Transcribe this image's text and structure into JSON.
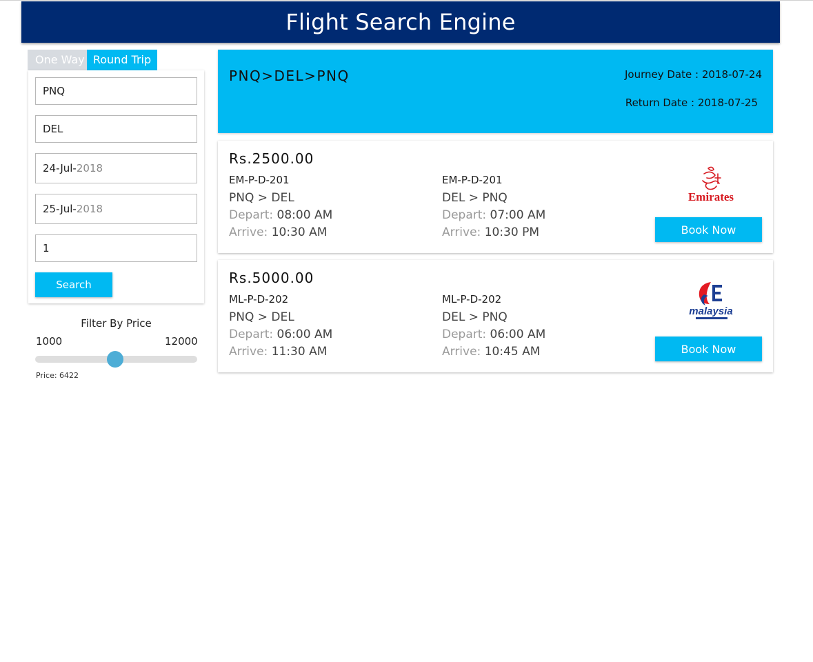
{
  "header": {
    "title": "Flight Search Engine"
  },
  "tabs": [
    {
      "label": "One Way",
      "active": false
    },
    {
      "label": "Round Trip",
      "active": true
    }
  ],
  "search": {
    "origin": "PNQ",
    "destination": "DEL",
    "depart_date": {
      "day_month": "24-Jul-",
      "year": "2018"
    },
    "return_date": {
      "day_month": "25-Jul-",
      "year": "2018"
    },
    "passengers": "1",
    "button_label": "Search"
  },
  "filter": {
    "title": "Filter By Price",
    "min_label": "1000",
    "max_label": "12000",
    "min": 1000,
    "max": 12000,
    "value": 6422,
    "price_text": "Price: 6422"
  },
  "results_header": {
    "route": "PNQ>DEL>PNQ",
    "journey_date": "Journey Date : 2018-07-24",
    "return_date": "Return Date : 2018-07-25"
  },
  "flights": [
    {
      "price": "Rs.2500.00",
      "outbound": {
        "code": "EM-P-D-201",
        "route": "PNQ > DEL",
        "depart_label": "Depart:",
        "depart_time": "08:00 AM",
        "arrive_label": "Arrive:",
        "arrive_time": "10:30 AM"
      },
      "return": {
        "code": "EM-P-D-201",
        "route": "DEL > PNQ",
        "depart_label": "Depart:",
        "depart_time": "07:00 AM",
        "arrive_label": "Arrive:",
        "arrive_time": "10:30 PM"
      },
      "logo_icon": "emirates-logo",
      "logo_text": "Emirates",
      "book_label": "Book Now"
    },
    {
      "price": "Rs.5000.00",
      "outbound": {
        "code": "ML-P-D-202",
        "route": "PNQ > DEL",
        "depart_label": "Depart:",
        "depart_time": "06:00 AM",
        "arrive_label": "Arrive:",
        "arrive_time": "11:30 AM"
      },
      "return": {
        "code": "ML-P-D-202",
        "route": "DEL > PNQ",
        "depart_label": "Depart:",
        "depart_time": "06:00 AM",
        "arrive_label": "Arrive:",
        "arrive_time": "10:45 AM"
      },
      "logo_icon": "malaysia-airlines-logo",
      "logo_text": "malaysia",
      "book_label": "Book Now"
    }
  ],
  "colors": {
    "header_bg": "#002a72",
    "accent": "#00b9f2",
    "inactive_tab": "#d7dbe0",
    "slider_thumb": "#4dadd6",
    "emirates_red": "#d71a21",
    "malaysia_blue": "#1d3f94",
    "malaysia_red": "#e31b23"
  }
}
